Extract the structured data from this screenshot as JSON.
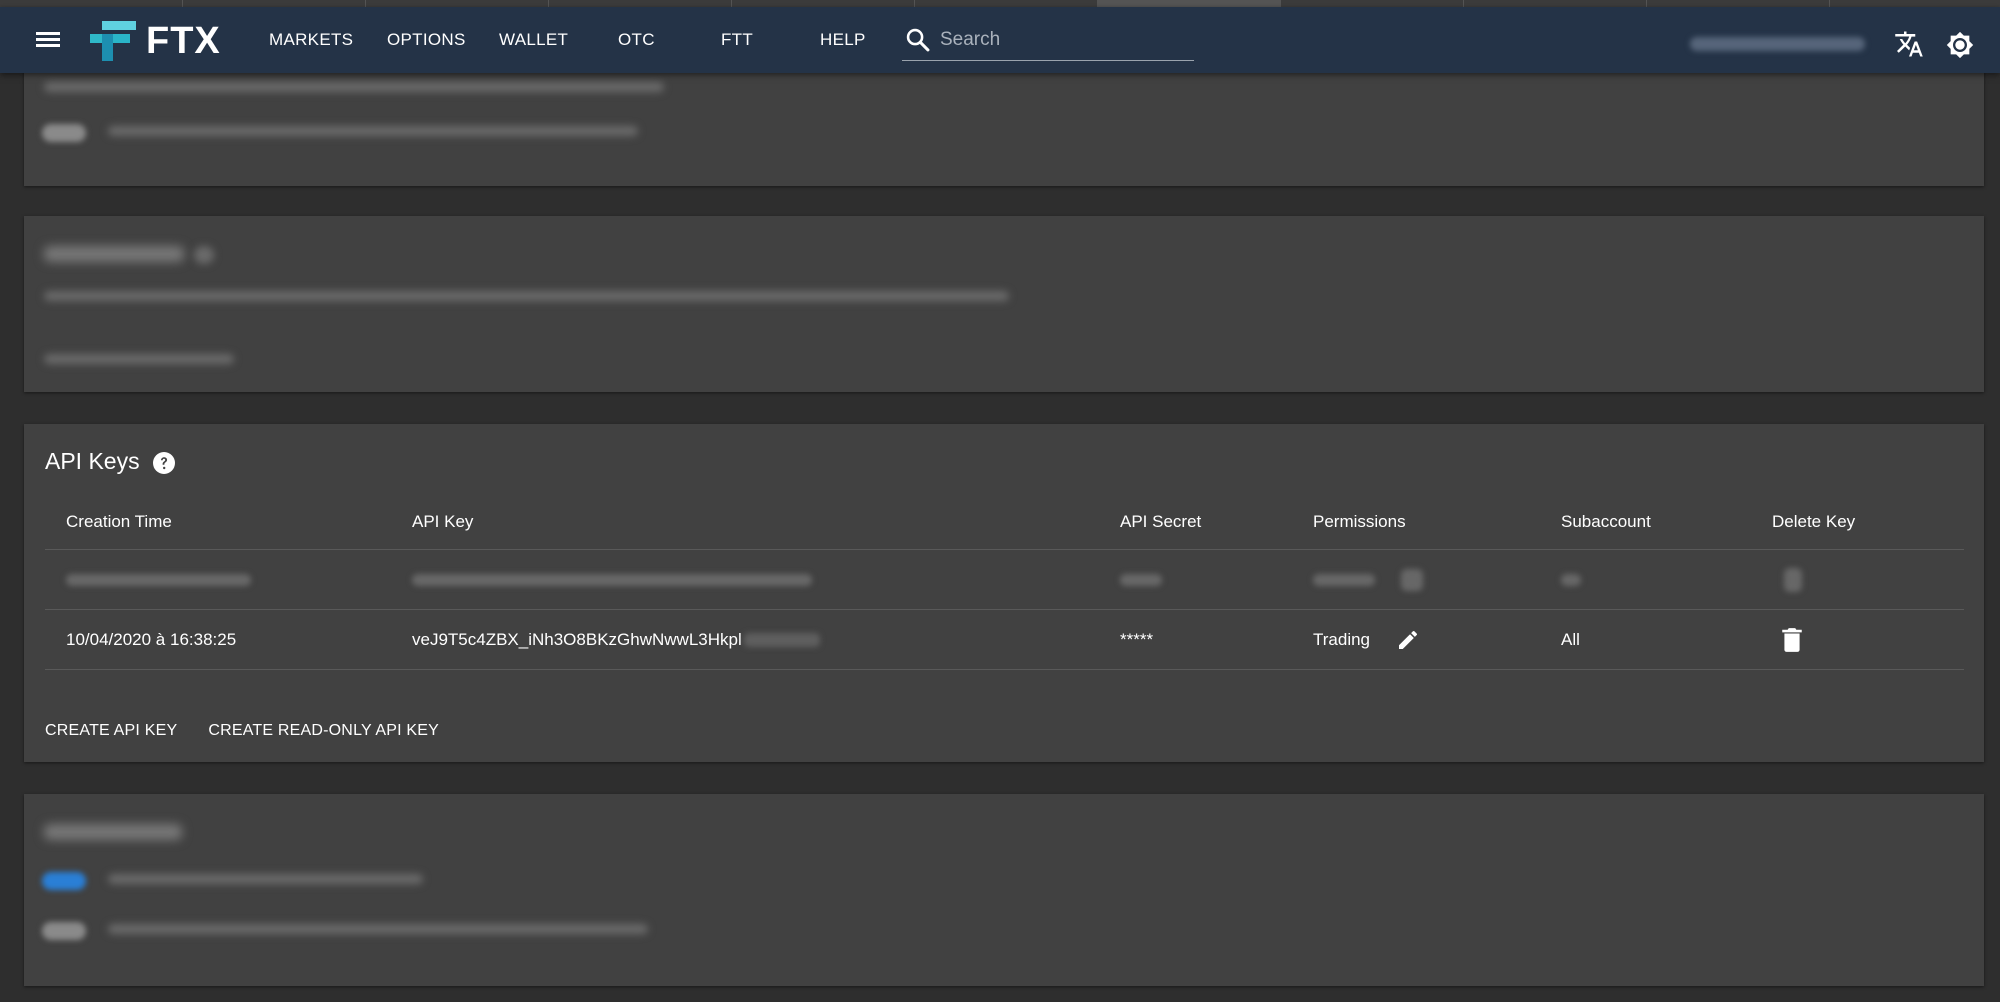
{
  "header": {
    "logo_text": "FTX",
    "nav": [
      {
        "label": "MARKETS"
      },
      {
        "label": "OPTIONS"
      },
      {
        "label": "WALLET"
      },
      {
        "label": "OTC"
      },
      {
        "label": "FTT"
      },
      {
        "label": "HELP"
      }
    ],
    "search": {
      "placeholder": "Search",
      "value": ""
    }
  },
  "api_keys": {
    "title": "API Keys",
    "columns": [
      "Creation Time",
      "API Key",
      "API Secret",
      "Permissions",
      "Subaccount",
      "Delete Key"
    ],
    "row": {
      "creation_time": "10/04/2020 à 16:38:25",
      "api_key": "veJ9T5c4ZBX_iNh3O8BKzGhwNwwL3Hkpl",
      "api_secret": "*****",
      "permissions": "Trading",
      "subaccount": "All"
    },
    "actions": {
      "create": "CREATE API KEY",
      "create_readonly": "CREATE READ-ONLY API KEY"
    }
  },
  "colors": {
    "navbar": "#243347",
    "card": "#414141",
    "page": "#2e2e2e",
    "logo_accent": "#2ab5c8",
    "toggle_on": "#2a7fd6"
  }
}
